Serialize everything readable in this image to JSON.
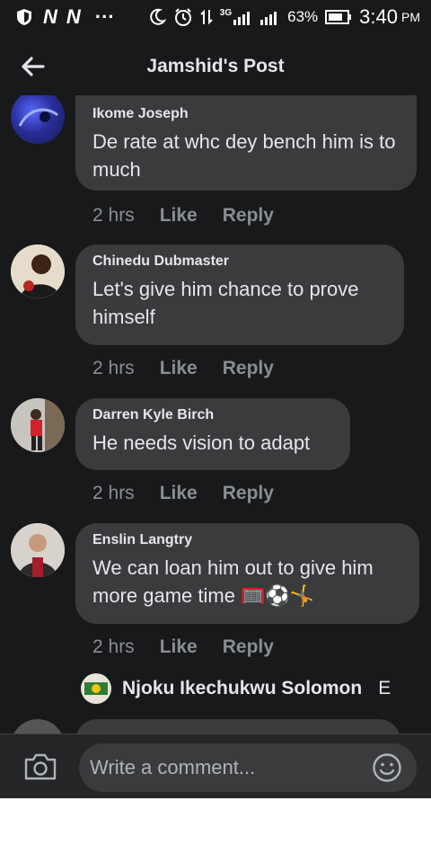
{
  "status_bar": {
    "carrier_icons": [
      "N",
      "N"
    ],
    "dots": "···",
    "network": "3G",
    "battery": "63%",
    "time": "3:40",
    "ampm": "PM"
  },
  "header": {
    "title": "Jamshid's Post"
  },
  "comments": [
    {
      "author": "Ikome Joseph",
      "text": "De rate at whc dey bench him is to much",
      "time": "2 hrs",
      "like": "Like",
      "reply": "Reply"
    },
    {
      "author": "Chinedu Dubmaster",
      "text": "Let's give him chance to prove himself",
      "time": "2 hrs",
      "like": "Like",
      "reply": "Reply"
    },
    {
      "author": "Darren Kyle Birch",
      "text": "He needs vision to adapt",
      "time": "2 hrs",
      "like": "Like",
      "reply": "Reply"
    },
    {
      "author": "Enslin Langtry",
      "text": "We can loan him out to give him more game time 🥅⚽🤸",
      "time": "2 hrs",
      "like": "Like",
      "reply": "Reply"
    }
  ],
  "reply_preview": {
    "name": "Njoku Ikechukwu Solomon",
    "trail": "E"
  },
  "composer": {
    "placeholder": "Write a comment..."
  }
}
